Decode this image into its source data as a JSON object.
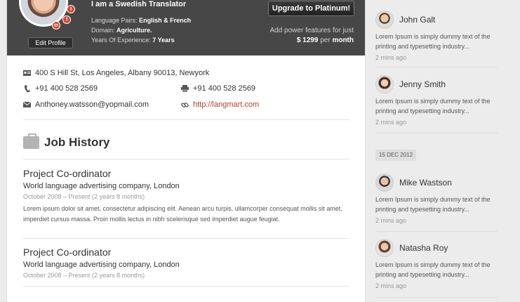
{
  "profile": {
    "headline": "I am a Swedish Translator",
    "language_pairs_label": "Language Pairs:",
    "language_pairs_value": "English & French",
    "domain_label": "Domain:",
    "domain_value": "Agriculture.",
    "experience_label": "Years Of Experience:",
    "experience_value": "7 Years",
    "edit_profile_label": "Edit Profile",
    "upgrade_label": "Upgrade to Platinum!",
    "power_text": "Add power features for just",
    "price_amount": "$ 1299",
    "price_per": "per",
    "price_period": "month",
    "social": {
      "twitter": "t",
      "facebook": "f",
      "linkedin": "in"
    }
  },
  "contact": {
    "address": "400 S Hill St, Los Angeles, Albany 90013, Newyork",
    "phone": "+91 400 528 2569",
    "fax": "+91 400 528 2569",
    "email": "Anthoney.watsson@yopmail.com",
    "website": "http://langmart.com"
  },
  "job_history": {
    "title": "Job History",
    "items": [
      {
        "role": "Project Co-ordinator",
        "company": "World language advertising company, London",
        "dates": "October 2008 – Present (2 years 8 months)",
        "description": "Lorem ipsum dolor sit amet, consectetur adipiscing elit. Aenean arcu turpis, ullamcorper consequat mollis sit amet, imperdiet cursus massa. Proin mollis lectus in nibh scelerisque sed imperdiet augue feugiat."
      },
      {
        "role": "Project Co-ordinator",
        "company": "World language advertising company, London",
        "dates": "October 2008 – Present (2 years 8 months)"
      }
    ]
  },
  "activity": {
    "items": [
      {
        "name": "John Galt",
        "text": "Lorem Ipsum is simply dummy text of the printing and typesetting industry...",
        "time": "2 mins ago"
      },
      {
        "name": "Jenny Smith",
        "text": "Lorem Ipsum is simply dummy text of the printing and typesetting industry...",
        "time": "2 mins ago"
      },
      {
        "name": "Mike Wastson",
        "text": "Lorem Ipsum is simply dummy text of the printing and typesetting industry...",
        "time": "2 mins ago"
      },
      {
        "name": "Natasha Roy",
        "text": "Lorem Ipsum is simply dummy text of the printing and typesetting industry...",
        "time": "2 mins ago"
      }
    ],
    "date_badge": "15 DEC 2012"
  },
  "colors": {
    "header_bg": "#474747",
    "link": "#c0392b",
    "social": "#d9452f"
  }
}
